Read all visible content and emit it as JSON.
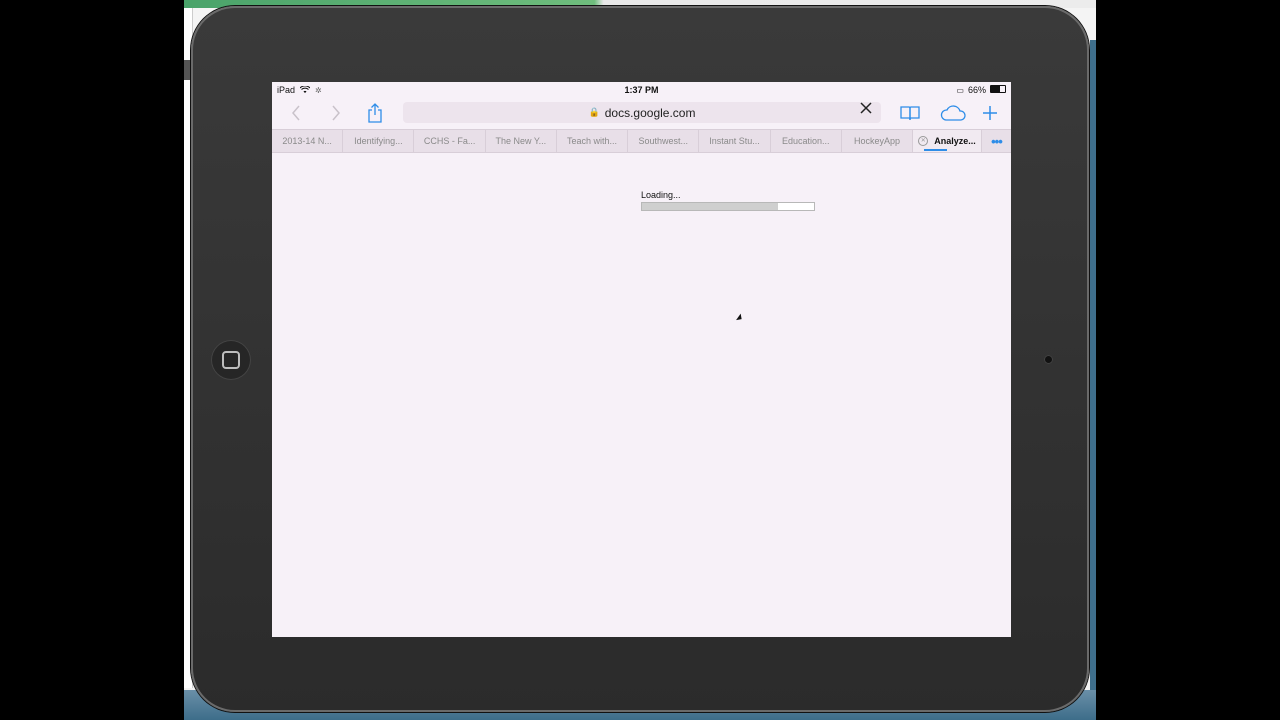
{
  "status_bar": {
    "device": "iPad",
    "time": "1:37 PM",
    "battery": "66%"
  },
  "url_bar": {
    "url": "docs.google.com",
    "back_icon": "chevron-left-icon",
    "forward_icon": "chevron-right-icon",
    "share_icon": "share-icon",
    "clear_icon": "close-icon",
    "bookmarks_icon": "book-icon",
    "cloud_icon": "cloud-icon",
    "new_tab_icon": "plus-icon"
  },
  "tabs": [
    {
      "label": "2013-14 N..."
    },
    {
      "label": "Identifying..."
    },
    {
      "label": "CCHS - Fa..."
    },
    {
      "label": "The New Y..."
    },
    {
      "label": "Teach with..."
    },
    {
      "label": "Southwest..."
    },
    {
      "label": "Instant Stu..."
    },
    {
      "label": "Education..."
    },
    {
      "label": "HockeyApp"
    },
    {
      "label": "Analyze...",
      "active": true
    }
  ],
  "tab_more": "•••",
  "content": {
    "loading_text": "Loading...",
    "loading_progress": 0.79
  },
  "colors": {
    "accent": "#2e8de8",
    "page_bg": "#f7f1f8"
  }
}
